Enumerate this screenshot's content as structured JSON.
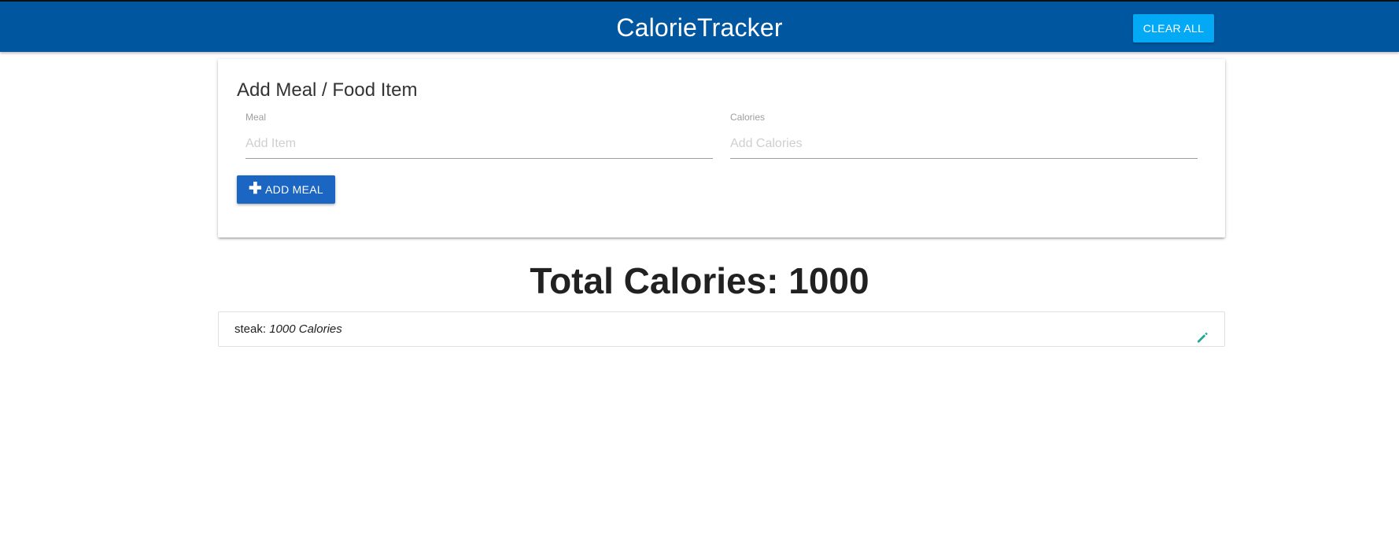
{
  "navbar": {
    "brand": "CalorieTracker",
    "clear_all_label": "CLEAR ALL",
    "background": "#0057a0",
    "clear_button_color": "#03a9f4"
  },
  "form": {
    "title": "Add Meal / Food Item",
    "meal": {
      "label": "Meal",
      "placeholder": "Add Item",
      "value": ""
    },
    "calories": {
      "label": "Calories",
      "placeholder": "Add Calories",
      "value": ""
    },
    "add_button_label": "ADD MEAL",
    "add_button_icon": "plus-icon",
    "add_button_color": "#1a66c2"
  },
  "total": {
    "text": "Total Calories: 1000"
  },
  "items": [
    {
      "name": "steak:",
      "calories_text": "1000 Calories",
      "action_icon": "pencil-icon",
      "action_color": "#26a69a"
    }
  ]
}
